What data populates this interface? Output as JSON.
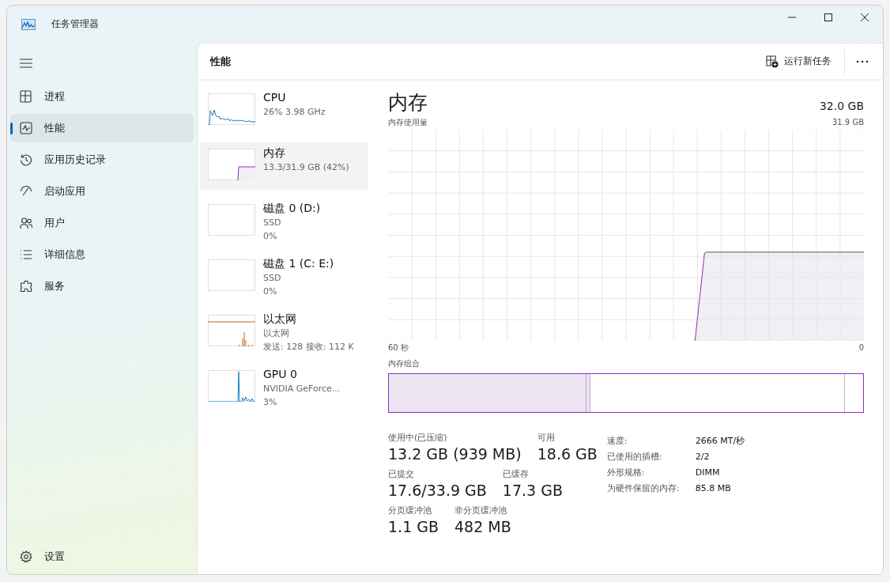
{
  "window": {
    "title": "任务管理器"
  },
  "nav": [
    {
      "label": "进程",
      "kind": "processes",
      "selected": false
    },
    {
      "label": "性能",
      "kind": "performance",
      "selected": true
    },
    {
      "label": "应用历史记录",
      "kind": "history",
      "selected": false
    },
    {
      "label": "启动应用",
      "kind": "startup",
      "selected": false
    },
    {
      "label": "用户",
      "kind": "users",
      "selected": false
    },
    {
      "label": "详细信息",
      "kind": "details",
      "selected": false
    },
    {
      "label": "服务",
      "kind": "services",
      "selected": false
    }
  ],
  "settings": {
    "label": "设置"
  },
  "header": {
    "title": "性能",
    "run_task": "运行新任务"
  },
  "devices": [
    {
      "kind": "cpu",
      "title": "CPU",
      "lines": [
        "26% 3.98 GHz"
      ],
      "selected": false
    },
    {
      "kind": "memory",
      "title": "内存",
      "lines": [
        "13.3/31.9 GB (42%)"
      ],
      "selected": true
    },
    {
      "kind": "disk",
      "title": "磁盘 0 (D:)",
      "lines": [
        "SSD",
        "0%"
      ],
      "selected": false
    },
    {
      "kind": "disk",
      "title": "磁盘 1 (C: E:)",
      "lines": [
        "SSD",
        "0%"
      ],
      "selected": false
    },
    {
      "kind": "ethernet",
      "title": "以太网",
      "lines": [
        "以太网",
        "发送: 128 接收: 112 K"
      ],
      "selected": false
    },
    {
      "kind": "gpu",
      "title": "GPU 0",
      "lines": [
        "NVIDIA GeForce...",
        "3%"
      ],
      "selected": false
    }
  ],
  "detail": {
    "title": "内存",
    "total": "32.0 GB",
    "usage_label": "内存使用量",
    "usage_max": "31.9 GB",
    "time_start": "60 秒",
    "time_end": "0",
    "composition_label": "内存组合",
    "stats": [
      [
        {
          "label": "使用中(已压缩)",
          "value": "13.2 GB (939 MB)"
        },
        {
          "label": "可用",
          "value": "18.6 GB"
        }
      ],
      [
        {
          "label": "已提交",
          "value": "17.6/33.9 GB"
        },
        {
          "label": "已缓存",
          "value": "17.3 GB"
        }
      ],
      [
        {
          "label": "分页缓冲池",
          "value": "1.1 GB"
        },
        {
          "label": "非分页缓冲池",
          "value": "482 MB"
        }
      ]
    ],
    "specs": [
      {
        "label": "速度:",
        "value": "2666 MT/秒"
      },
      {
        "label": "已使用的插槽:",
        "value": "2/2"
      },
      {
        "label": "外形规格:",
        "value": "DIMM"
      },
      {
        "label": "为硬件保留的内存:",
        "value": "85.8 MB"
      }
    ]
  }
}
